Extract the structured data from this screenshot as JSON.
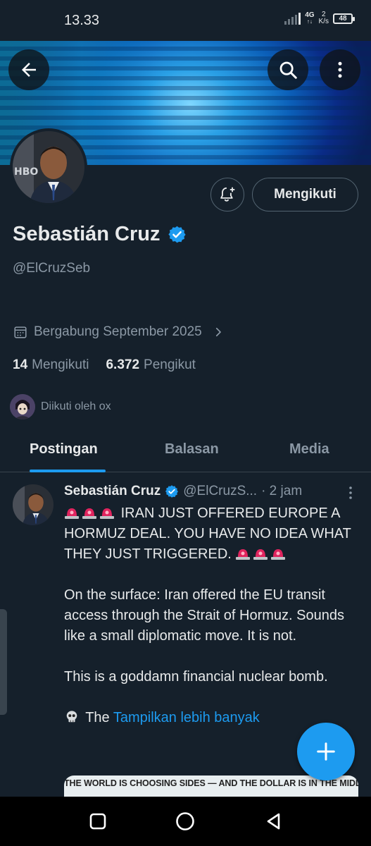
{
  "status_bar": {
    "time": "13.33",
    "network": "4G",
    "speed_value": "2",
    "speed_unit": "K/s",
    "battery": "48"
  },
  "header": {
    "back_icon": "arrow-left-icon",
    "search_icon": "search-icon",
    "more_icon": "more-vertical-icon"
  },
  "profile": {
    "display_name": "Sebastián Cruz",
    "verified": true,
    "handle": "@ElCruzSeb",
    "joined": "Bergabung September 2025",
    "following_count": "14",
    "following_label": "Mengikuti",
    "followers_count": "6.372",
    "followers_label": "Pengikut",
    "followed_by": "Diikuti oleh ox",
    "follow_button_label": "Mengikuti",
    "notify_icon": "bell-plus-icon"
  },
  "tabs": [
    {
      "label": "Postingan",
      "active": true
    },
    {
      "label": "Balasan",
      "active": false
    },
    {
      "label": "Media",
      "active": false
    }
  ],
  "tweet": {
    "author_name": "Sebastián Cruz",
    "author_handle": "@ElCruzS...",
    "time": "· 2 jam",
    "line1": "IRAN JUST OFFERED EUROPE A HORMUZ DEAL. YOU HAVE NO IDEA WHAT THEY JUST TRIGGERED.",
    "para2": "On the surface: Iran offered the EU transit access through the Strait of Hormuz. Sounds like a small diplomatic move. It is not.",
    "para3": "This is a goddamn financial nuclear bomb.",
    "para4_prefix": "The",
    "show_more": "Tampilkan lebih banyak",
    "media_caption": "THE WORLD IS CHOOSING SIDES — AND THE DOLLAR IS IN THE MIDDLE."
  },
  "colors": {
    "background": "#15202b",
    "accent": "#1d9bf0",
    "muted": "#8b98a5"
  }
}
